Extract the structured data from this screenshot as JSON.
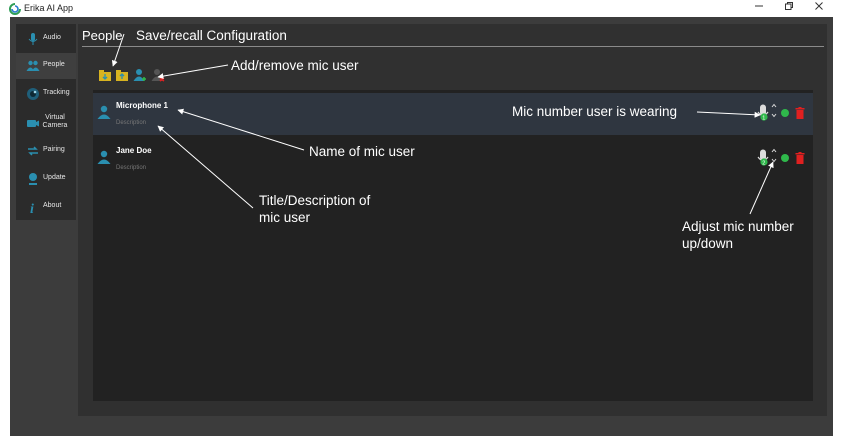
{
  "window": {
    "title": "Erika AI App",
    "controls": [
      "minimize-icon",
      "restore-icon",
      "close-icon"
    ]
  },
  "sidebar": {
    "items": [
      {
        "label": "Audio",
        "icon": "microphone-icon",
        "active": false
      },
      {
        "label": "People",
        "icon": "people-icon",
        "active": true
      },
      {
        "label": "Tracking",
        "icon": "tracking-icon",
        "active": false
      },
      {
        "label": "Virtual Camera",
        "icon": "camera-icon",
        "active": false
      },
      {
        "label": "Pairing",
        "icon": "pairing-icon",
        "active": false
      },
      {
        "label": "Update",
        "icon": "update-icon",
        "active": false
      },
      {
        "label": "About",
        "icon": "info-icon",
        "active": false
      }
    ]
  },
  "main": {
    "title": "People",
    "toolbar": [
      "save-config-icon",
      "recall-config-icon",
      "add-user-icon",
      "remove-user-icon"
    ]
  },
  "users": [
    {
      "name": "Microphone 1",
      "description": "Description",
      "selected": true
    },
    {
      "name": "Jane Doe",
      "description": "Description",
      "selected": false
    }
  ],
  "annotations": {
    "save_recall": "Save/recall Configuration",
    "add_remove": "Add/remove mic user",
    "mic_number": "Mic number user is wearing",
    "name_of_user": "Name of mic user",
    "title_desc_1": "Title/Description of",
    "title_desc_2": "mic user",
    "adjust_1": "Adjust mic number",
    "adjust_2": "up/down"
  },
  "colors": {
    "frame": "#3c3c3c",
    "sidebar": "#2b2b2b",
    "list": "#222222",
    "selected_row": "#2f3640",
    "accent_teal": "#2a8fb0",
    "status_green": "#2fb84b",
    "delete_red": "#e02020"
  }
}
